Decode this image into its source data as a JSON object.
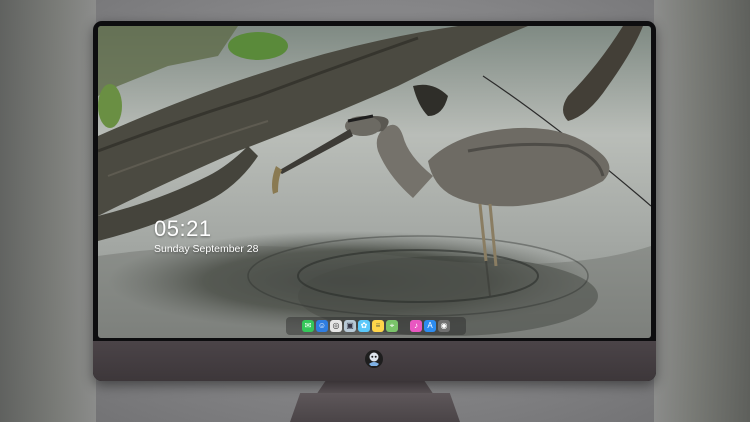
{
  "lockscreen": {
    "time": "05:21",
    "date": "Sunday September  28"
  },
  "dock": {
    "left_apps": [
      {
        "icon": "messages-icon",
        "color": "#34c759",
        "glyph": "✉"
      },
      {
        "icon": "finder-icon",
        "color": "#2f7de1",
        "glyph": "☺"
      },
      {
        "icon": "safari-icon",
        "color": "#e6e6e6",
        "glyph": "◎"
      },
      {
        "icon": "preview-icon",
        "color": "#b7c9d6",
        "glyph": "▣"
      },
      {
        "icon": "photos-icon",
        "color": "#5ac8fa",
        "glyph": "✿"
      },
      {
        "icon": "notes-icon",
        "color": "#ffd54a",
        "glyph": "≡"
      },
      {
        "icon": "maps-icon",
        "color": "#7ac36a",
        "glyph": "⌖"
      }
    ],
    "right_apps": [
      {
        "icon": "itunes-icon",
        "color": "#e957c1",
        "glyph": "♪"
      },
      {
        "icon": "app-store-icon",
        "color": "#2d8cf0",
        "glyph": "A"
      },
      {
        "icon": "camera-icon",
        "color": "#707070",
        "glyph": "◉"
      }
    ]
  },
  "colors": {
    "monitor_bezel": "#0d0d0f",
    "monitor_chin": "#433d40",
    "water": "#9fa5a2",
    "heron": "#6b6963"
  }
}
